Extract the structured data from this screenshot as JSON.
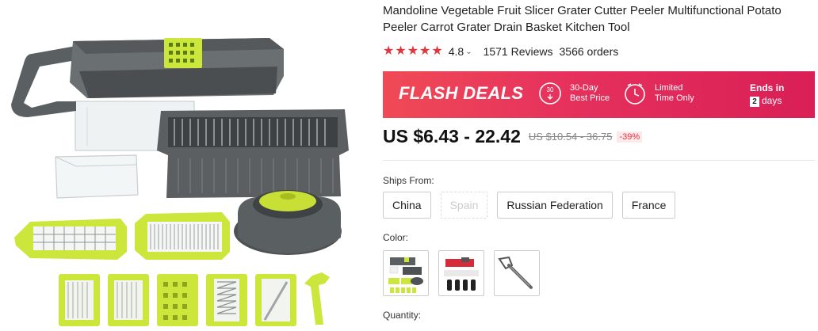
{
  "product": {
    "title": "Mandoline Vegetable Fruit Slicer Grater Cutter Peeler Multifunctional Potato Peeler Carrot Grater Drain Basket Kitchen Tool",
    "rating": "4.8",
    "stars": 5,
    "reviews": "1571 Reviews",
    "orders": "3566 orders"
  },
  "flash": {
    "title": "FLASH DEALS",
    "icon1_number": "30",
    "feature1_line1": "30-Day",
    "feature1_line2": "Best Price",
    "feature2_line1": "Limited",
    "feature2_line2": "Time Only",
    "ends_label": "Ends in",
    "ends_days_value": "2",
    "ends_days_unit": "days"
  },
  "price": {
    "current": "US $6.43 - 22.42",
    "original": "US $10.54 - 36.75",
    "discount": "-39%"
  },
  "ships": {
    "label": "Ships From:",
    "options": [
      "China",
      "Spain",
      "Russian Federation",
      "France"
    ]
  },
  "color": {
    "label": "Color:"
  },
  "quantity": {
    "label": "Quantity:"
  },
  "colors": {
    "accent": "#e1363f",
    "flash_gradient_start": "#f04a55",
    "flash_gradient_end": "#d91f56",
    "product_green": "#cde63c",
    "product_gray": "#4e5254"
  }
}
